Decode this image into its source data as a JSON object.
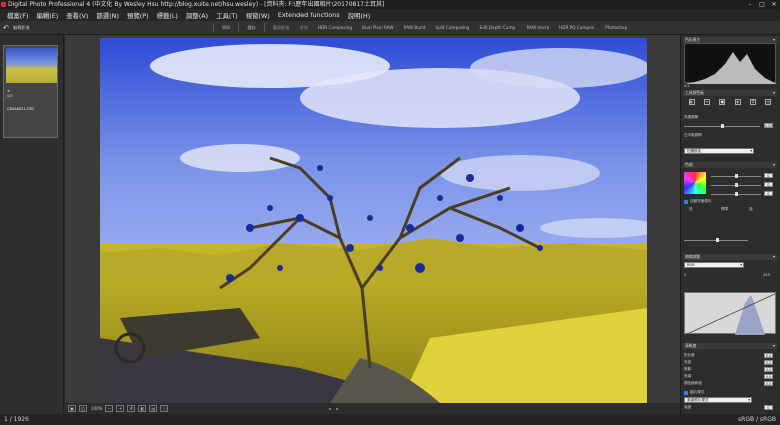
{
  "window": {
    "title": "Digital Photo Professional 4 (中文化 By Wesley Hsu http://blog.xuite.net/hsu.wesley) - [資料夾: F:\\歷年出國相片\\20170817土耳其]",
    "buttons": [
      "–",
      "□",
      "✕"
    ]
  },
  "menu": [
    "檔案(F)",
    "編輯(E)",
    "查看(V)",
    "篩選(N)",
    "預覽(P)",
    "標籤(L)",
    "調整(A)",
    "工具(T)",
    "視窗(W)",
    "Extended functions",
    "說明(H)"
  ],
  "toolbar": {
    "back_label": "編輯影像",
    "buttons": [
      "列印",
      "儲存",
      "重設影像",
      "合成",
      "HDR Composing",
      "Dual Pixel RAW",
      "RAW Burst",
      "Split Composing",
      "Edit Depth Comp.",
      "RAW micro",
      "HDR PQ Compos.",
      "Photoshop"
    ]
  },
  "filmstrip": {
    "thumbnail_label": "CB5A6021.CR2",
    "thumbnail_meta": [
      "★",
      "0/0"
    ]
  },
  "viewbar": {
    "zoom": "100%",
    "extra": [
      "◂",
      "▸"
    ]
  },
  "status": {
    "count": "1 / 1926",
    "color_space": "sRGB / sRGB"
  },
  "rpanel": {
    "histogram_title": "色彩直方",
    "histogram_values": [
      "0/1",
      "0",
      "0"
    ],
    "tools_title": "工具調色板",
    "brightness_label": "亮度調節",
    "brightness_value": "0.00",
    "picture_style_title": "白平衡調節",
    "picture_style_value": "拍攝設定",
    "color_title": "色調",
    "color_values": [
      "0",
      "0",
      "0"
    ],
    "auto_label": "自動亮度優化",
    "auto_opts": [
      "低",
      "標準",
      "強"
    ],
    "tone_curve_title": "曲線調整",
    "tone_curve_mode": "RGB",
    "tone_curve_range": [
      "0",
      "255"
    ],
    "sharpness_title": "清晰度",
    "rows": [
      {
        "label": "對比度",
        "value": "0.0"
      },
      {
        "label": "亮部",
        "value": "0.0"
      },
      {
        "label": "陰影",
        "value": "0.0"
      },
      {
        "label": "色調",
        "value": "0.0"
      },
      {
        "label": "顏色飽和度",
        "value": "0.0"
      }
    ],
    "style_label": "圖片樣式",
    "style_value": "風景照片樣式",
    "style_strength_label": "強度",
    "style_strength_value": "0"
  },
  "colors": {
    "sky": "#3a55d3",
    "ground": "#c9bd2e"
  }
}
